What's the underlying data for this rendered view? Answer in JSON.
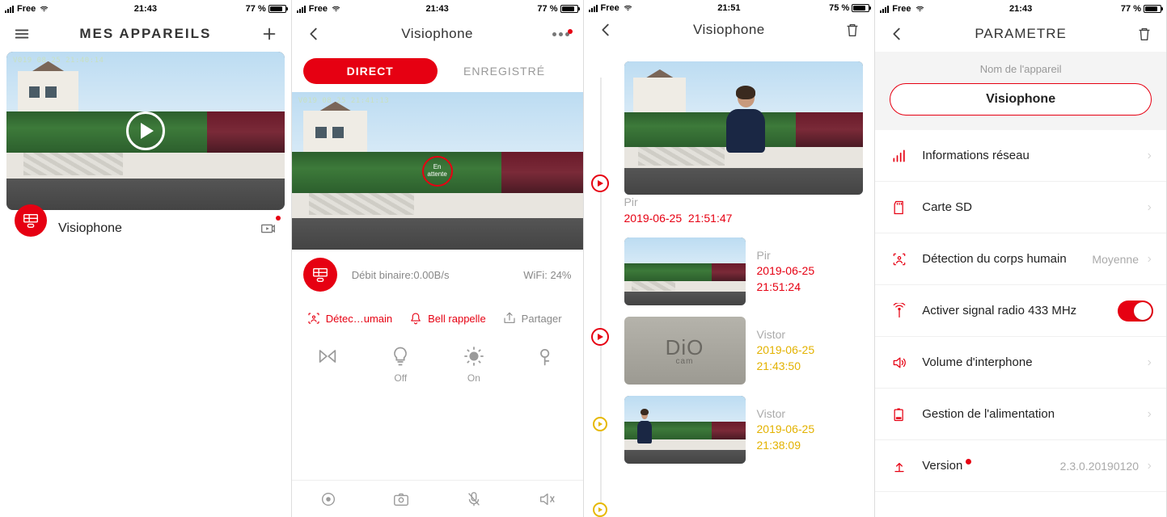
{
  "status": {
    "carrier": "Free",
    "signal_wifi": true
  },
  "screens": [
    {
      "time": "21:43",
      "battery_pct": "77 %",
      "battery_fill": 0.77,
      "title": "MES APPAREILS",
      "preview_ts": "V019 08 25 21:40:14",
      "device_name": "Visiophone"
    },
    {
      "time": "21:43",
      "battery_pct": "77 %",
      "battery_fill": 0.77,
      "title": "Visiophone",
      "tab_direct": "DIRECT",
      "tab_rec": "ENREGISTRÉ",
      "wait_text": "En\nattente",
      "bitrate_label": "Débit binaire:",
      "bitrate_value": "0.00B/s",
      "wifi_label": "WiFi:",
      "wifi_value": "24%",
      "preview_ts": "V019 08 25 21:41:13",
      "actions": {
        "human": "Détec…umain",
        "bell": "Bell rappelle",
        "share": "Partager"
      },
      "grid": {
        "off": "Off",
        "on": "On"
      }
    },
    {
      "time": "21:51",
      "battery_pct": "75 %",
      "battery_fill": 0.75,
      "title": "Visiophone",
      "events": [
        {
          "type": "Pir",
          "date": "2019-06-25",
          "time": "21:51:47",
          "color": "red",
          "large": true,
          "kind": "person"
        },
        {
          "type": "Pir",
          "date": "2019-06-25",
          "time": "21:51:24",
          "color": "red",
          "large": false,
          "kind": "street"
        },
        {
          "type": "Vistor",
          "date": "2019-06-25",
          "time": "21:43:50",
          "color": "yellow",
          "large": false,
          "kind": "dio"
        },
        {
          "type": "Vistor",
          "date": "2019-06-25",
          "time": "21:38:09",
          "color": "yellow",
          "large": false,
          "kind": "street"
        }
      ]
    },
    {
      "time": "21:43",
      "battery_pct": "77 %",
      "battery_fill": 0.77,
      "title": "PARAMETRE",
      "device_label": "Nom de l'appareil",
      "device_name": "Visiophone",
      "rows": {
        "network": "Informations réseau",
        "sd": "Carte SD",
        "human": "Détection du corps humain",
        "human_v": "Moyenne",
        "radio": "Activer signal radio 433 MHz",
        "volume": "Volume d'interphone",
        "power": "Gestion de l'alimentation",
        "version": "Version",
        "version_v": "2.3.0.20190120"
      }
    }
  ],
  "dio_brand": "DiO",
  "dio_sub": "cam"
}
